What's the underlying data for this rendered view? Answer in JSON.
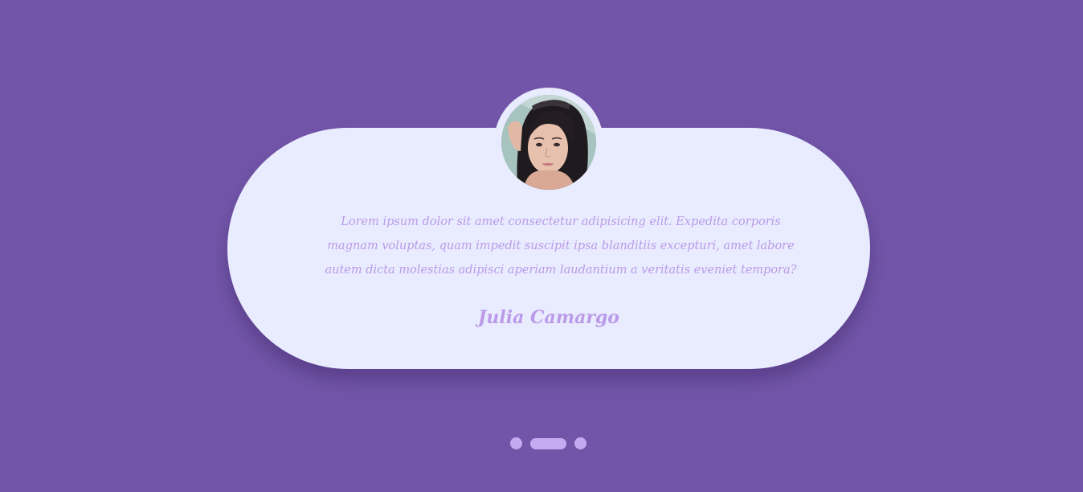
{
  "testimonial": {
    "quote": "Lorem ipsum dolor sit amet consectetur adipisicing elit. Expedita corporis magnam voluptas, quam impedit suscipit ipsa blanditiis excepturi, amet labore autem dicta molestias adipisci aperiam laudantium a veritatis eveniet tempora?",
    "name": "Julia Camargo"
  },
  "carousel": {
    "slides": 3,
    "active_index": 1
  },
  "colors": {
    "background": "#7255a8",
    "card": "#e8ecfe",
    "text_accent": "#bb9ae9",
    "dot": "#c4abf1"
  }
}
